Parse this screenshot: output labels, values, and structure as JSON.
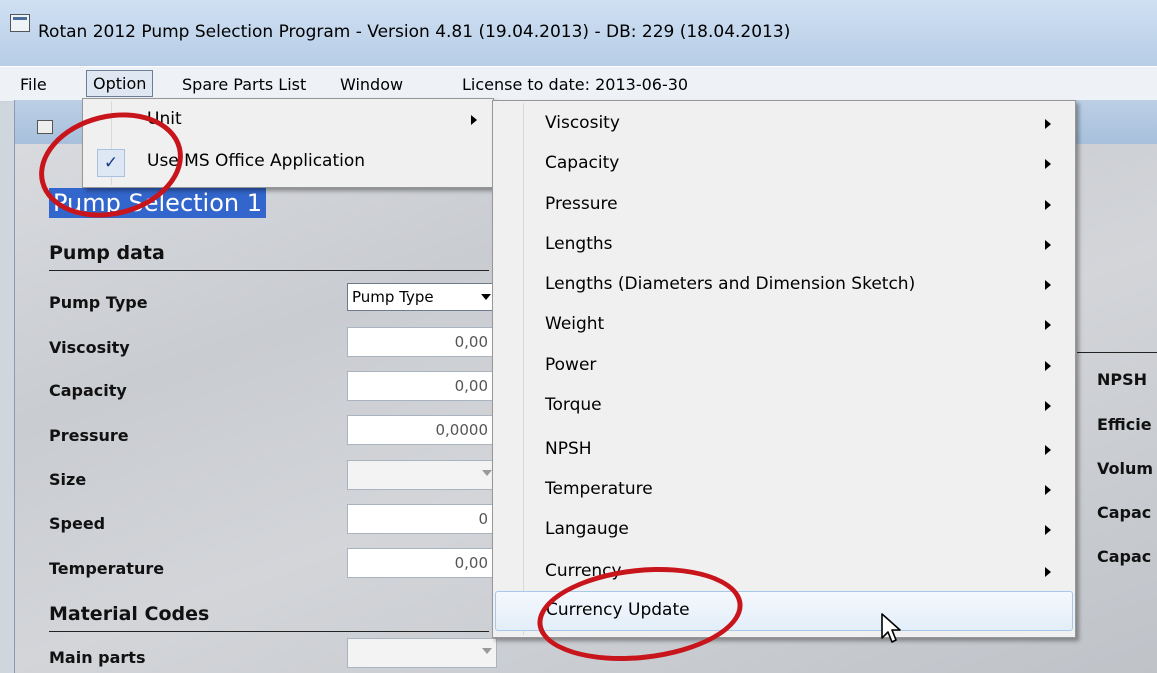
{
  "window": {
    "title": "Rotan 2012 Pump Selection Program - Version 4.81 (19.04.2013) - DB: 229 (18.04.2013)",
    "app_icon": "window-icon"
  },
  "menubar": {
    "file": "File",
    "option": "Option",
    "spare_parts": "Spare Parts List",
    "window": "Window",
    "license": "License to date: 2013-06-30"
  },
  "child": {
    "selection_name": "Pump Selection 1"
  },
  "pump_data": {
    "header": "Pump data",
    "rows": [
      {
        "label": "Pump Type",
        "value": "Pump Type"
      },
      {
        "label": "Viscosity",
        "value": "0,00"
      },
      {
        "label": "Capacity",
        "value": "0,00"
      },
      {
        "label": "Pressure",
        "value": "0,0000"
      },
      {
        "label": "Size",
        "value": ""
      },
      {
        "label": "Speed",
        "value": "0"
      },
      {
        "label": "Temperature",
        "value": "0,00"
      }
    ]
  },
  "material": {
    "header": "Material Codes",
    "main_parts": "Main parts"
  },
  "right_panel": [
    "NPSH",
    "Efficie",
    "Volum",
    "Capac",
    "Capac"
  ],
  "option_menu": {
    "unit": "Unit",
    "use_ms_office": "Use MS Office Application",
    "check_mark": "✓"
  },
  "unit_submenu": [
    "Viscosity",
    "Capacity",
    "Pressure",
    "Lengths",
    "Lengths (Diameters and Dimension Sketch)",
    "Weight",
    "Power",
    "Torque",
    "NPSH",
    "Temperature",
    "Langauge",
    "Currency",
    "Currency Update"
  ],
  "colors": {
    "highlight_circle": "#c8141b",
    "selection_bg": "#3366cc"
  }
}
